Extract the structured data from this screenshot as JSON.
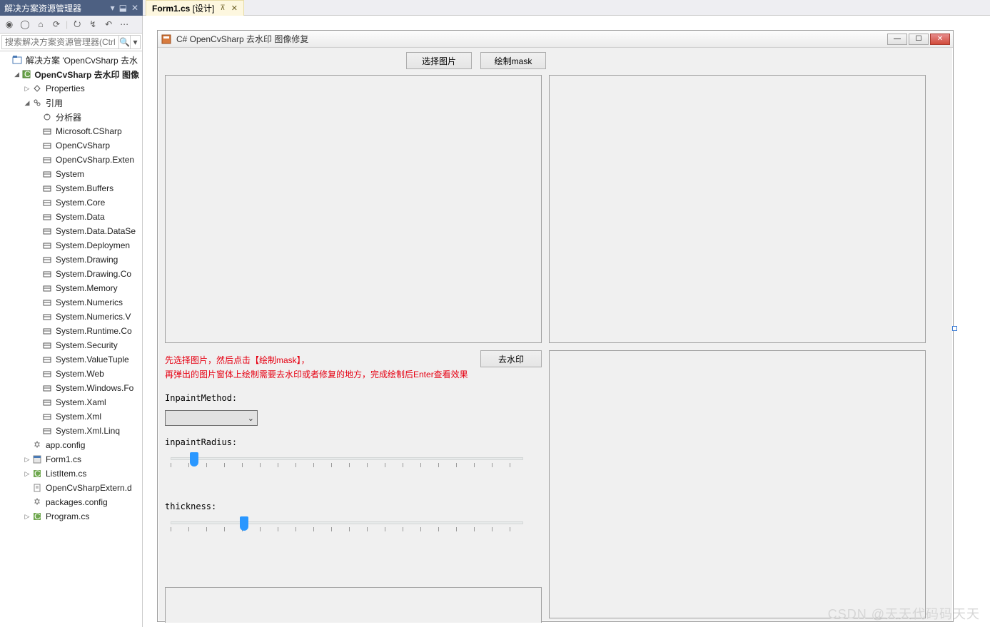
{
  "sidebar": {
    "title": "解决方案资源管理器",
    "search_placeholder": "搜索解决方案资源管理器(Ctrl+;)"
  },
  "tab": {
    "name": "Form1.cs",
    "mode": "[设计]"
  },
  "tree": {
    "solution": "解决方案 'OpenCvSharp 去水",
    "project": "OpenCvSharp 去水印 图像",
    "properties": "Properties",
    "references": "引用",
    "refs": [
      "分析器",
      "Microsoft.CSharp",
      "OpenCvSharp",
      "OpenCvSharp.Exten",
      "System",
      "System.Buffers",
      "System.Core",
      "System.Data",
      "System.Data.DataSe",
      "System.Deploymen",
      "System.Drawing",
      "System.Drawing.Co",
      "System.Memory",
      "System.Numerics",
      "System.Numerics.V",
      "System.Runtime.Co",
      "System.Security",
      "System.ValueTuple",
      "System.Web",
      "System.Windows.Fo",
      "System.Xaml",
      "System.Xml",
      "System.Xml.Linq"
    ],
    "files": [
      {
        "label": "app.config",
        "icon": "cfg"
      },
      {
        "label": "Form1.cs",
        "icon": "form",
        "exp": "▷"
      },
      {
        "label": "ListItem.cs",
        "icon": "cs",
        "exp": "▷"
      },
      {
        "label": "OpenCvSharpExtern.d",
        "icon": "dll"
      },
      {
        "label": "packages.config",
        "icon": "cfg"
      },
      {
        "label": "Program.cs",
        "icon": "cs",
        "exp": "▷"
      }
    ]
  },
  "form": {
    "title": "C# OpenCvSharp 去水印 图像修复",
    "btn_select": "选择图片",
    "btn_drawmask": "绘制mask",
    "btn_dewatermark": "去水印",
    "hint1": "先选择图片，然后点击【绘制mask】，",
    "hint2": "再弹出的图片窗体上绘制需要去水印或者修复的地方，完成绘制后Enter查看效果",
    "lbl_method": "InpaintMethod:",
    "lbl_radius": "inpaintRadius:",
    "lbl_thickness": "thickness:"
  },
  "watermark": "CSDN @天天代码码天天"
}
